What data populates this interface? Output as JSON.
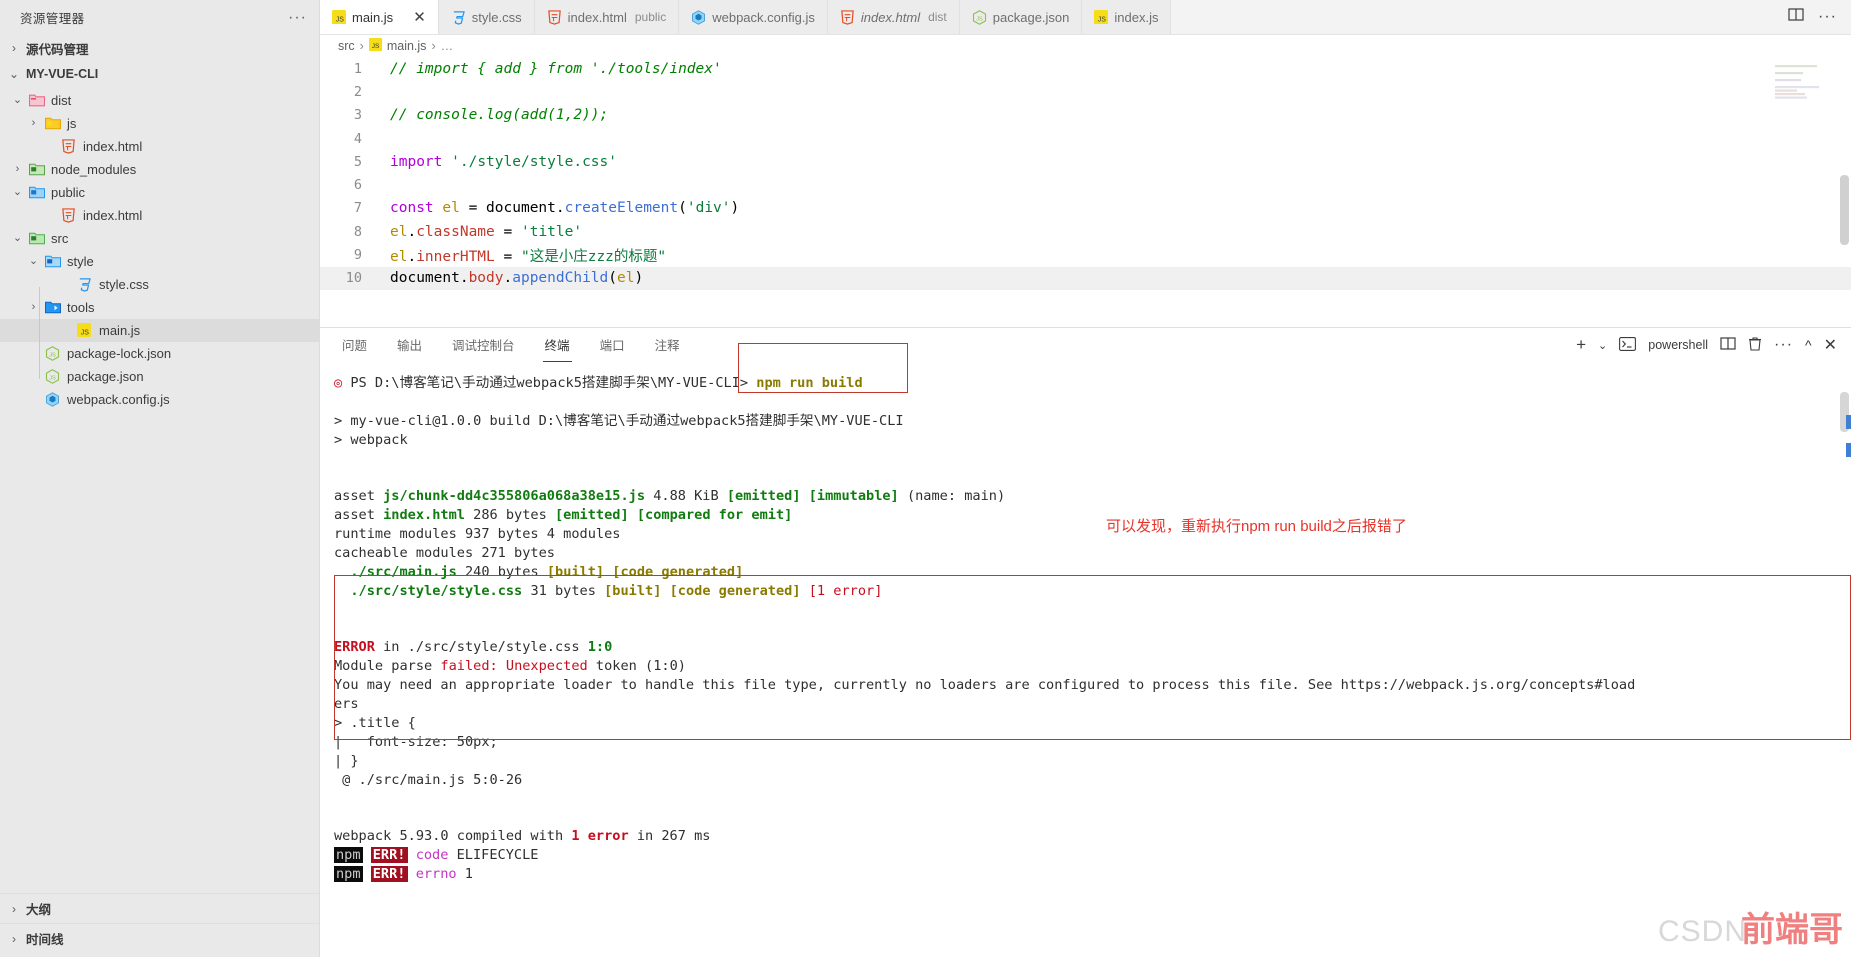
{
  "sidebar": {
    "title": "资源管理器",
    "more_icon": "ellipsis-icon",
    "sections": [
      {
        "label": "源代码管理",
        "expanded": false
      },
      {
        "label": "MY-VUE-CLI",
        "expanded": true
      }
    ],
    "tree": [
      {
        "label": "dist",
        "indent": 1,
        "twisty": "chevron-down",
        "icon": "folder-dist-icon",
        "selected": false
      },
      {
        "label": "js",
        "indent": 2,
        "twisty": "chevron-right",
        "icon": "folder-js-icon",
        "selected": false
      },
      {
        "label": "index.html",
        "indent": 3,
        "twisty": "",
        "icon": "html-file-icon",
        "selected": false
      },
      {
        "label": "node_modules",
        "indent": 1,
        "twisty": "chevron-right",
        "icon": "folder-node-icon",
        "selected": false
      },
      {
        "label": "public",
        "indent": 1,
        "twisty": "chevron-down",
        "icon": "folder-public-icon",
        "selected": false
      },
      {
        "label": "index.html",
        "indent": 3,
        "twisty": "",
        "icon": "html-file-icon",
        "selected": false
      },
      {
        "label": "src",
        "indent": 1,
        "twisty": "chevron-down",
        "icon": "folder-src-icon",
        "selected": false
      },
      {
        "label": "style",
        "indent": 2,
        "twisty": "chevron-down",
        "icon": "folder-style-icon",
        "selected": false
      },
      {
        "label": "style.css",
        "indent": 4,
        "twisty": "",
        "icon": "css-file-icon",
        "selected": false
      },
      {
        "label": "tools",
        "indent": 2,
        "twisty": "chevron-right",
        "icon": "folder-tools-icon",
        "selected": false
      },
      {
        "label": "main.js",
        "indent": 4,
        "twisty": "",
        "icon": "js-file-icon",
        "selected": true
      },
      {
        "label": "package-lock.json",
        "indent": 2,
        "twisty": "",
        "icon": "json-file-icon",
        "selected": false
      },
      {
        "label": "package.json",
        "indent": 2,
        "twisty": "",
        "icon": "json-file-icon",
        "selected": false
      },
      {
        "label": "webpack.config.js",
        "indent": 2,
        "twisty": "",
        "icon": "webpack-file-icon",
        "selected": false
      }
    ],
    "bottom_sections": [
      {
        "label": "大纲",
        "expanded": false
      },
      {
        "label": "时间线",
        "expanded": false
      }
    ]
  },
  "tabs": [
    {
      "label": "main.js",
      "sub": "",
      "icon": "js-file-icon",
      "active": true,
      "preview": false,
      "closable": true
    },
    {
      "label": "style.css",
      "sub": "",
      "icon": "css-file-icon",
      "active": false,
      "preview": false,
      "closable": false
    },
    {
      "label": "index.html",
      "sub": "public",
      "icon": "html-file-icon",
      "active": false,
      "preview": false,
      "closable": false
    },
    {
      "label": "webpack.config.js",
      "sub": "",
      "icon": "webpack-file-icon",
      "active": false,
      "preview": false,
      "closable": false
    },
    {
      "label": "index.html",
      "sub": "dist",
      "icon": "html-file-icon",
      "active": false,
      "preview": true,
      "closable": false
    },
    {
      "label": "package.json",
      "sub": "",
      "icon": "json-file-icon",
      "active": false,
      "preview": false,
      "closable": false
    },
    {
      "label": "index.js",
      "sub": "",
      "icon": "js-file-icon",
      "active": false,
      "preview": false,
      "closable": false
    }
  ],
  "tabbar_actions": [
    {
      "name": "split-editor-icon",
      "glyph": "▯"
    },
    {
      "name": "more-actions-icon",
      "glyph": "···"
    }
  ],
  "breadcrumb": {
    "root": "src",
    "file": "main.js",
    "tail": "…",
    "sep": "›",
    "icon": "js-file-icon"
  },
  "editor": {
    "active_line": 10,
    "lines": [
      {
        "n": 1,
        "text": "// import { add } from './tools/index'"
      },
      {
        "n": 2,
        "text": ""
      },
      {
        "n": 3,
        "text": "// console.log(add(1,2));"
      },
      {
        "n": 4,
        "text": ""
      },
      {
        "n": 5,
        "text": "import './style/style.css'"
      },
      {
        "n": 6,
        "text": ""
      },
      {
        "n": 7,
        "text": "const el = document.createElement('div')"
      },
      {
        "n": 8,
        "text": "el.className = 'title'"
      },
      {
        "n": 9,
        "text": "el.innerHTML = \"这是小庄zzz的标题\""
      },
      {
        "n": 10,
        "text": "document.body.appendChild(el)"
      }
    ]
  },
  "panel": {
    "tabs": [
      {
        "label": "问题",
        "active": false
      },
      {
        "label": "输出",
        "active": false
      },
      {
        "label": "调试控制台",
        "active": false
      },
      {
        "label": "终端",
        "active": true
      },
      {
        "label": "端口",
        "active": false
      },
      {
        "label": "注释",
        "active": false
      }
    ],
    "actions": {
      "new_terminal_icon": "plus-icon",
      "new_terminal_dropdown_icon": "chevron-down-icon",
      "shell_icon": "terminal-icon",
      "shell_name": "powershell",
      "split_icon": "split-panel-icon",
      "kill_icon": "trash-icon",
      "more_icon": "ellipsis-icon",
      "maximize_icon": "chevron-up-icon",
      "close_icon": "close-icon"
    },
    "terminal": {
      "prompt_status_icon": "error-circle-icon",
      "prompt": "PS D:\\博客笔记\\手动通过webpack5搭建脚手架\\MY-VUE-CLI>",
      "command": "npm run build",
      "lines": [
        "> my-vue-cli@1.0.0 build D:\\博客笔记\\手动通过webpack5搭建脚手架\\MY-VUE-CLI",
        "> webpack",
        "",
        "asset js/chunk-dd4c355806a068a38e15.js 4.88 KiB [emitted] [immutable] (name: main)",
        "asset index.html 286 bytes [emitted] [compared for emit]",
        "runtime modules 937 bytes 4 modules",
        "cacheable modules 271 bytes",
        "  ./src/main.js 240 bytes [built] [code generated]",
        "  ./src/style/style.css 31 bytes [built] [code generated] [1 error]"
      ],
      "asset_js_name": "js/chunk-dd4c355806a068a38e15.js",
      "asset_js_size": "4.88 KiB",
      "asset_js_tags": "[emitted] [immutable]",
      "asset_js_suffix": "(name: main)",
      "asset_html_name": "index.html",
      "asset_html_size": "286 bytes",
      "asset_html_tags": "[emitted] [compared for emit]",
      "runtime_modules": "runtime modules 937 bytes 4 modules",
      "cacheable_modules": "cacheable modules 271 bytes",
      "mod1_name": "./src/main.js",
      "mod1_size": "240 bytes",
      "mod1_tags": "[built] [code generated]",
      "mod2_name": "./src/style/style.css",
      "mod2_size": "31 bytes",
      "mod2_tags": "[built] [code generated]",
      "mod2_error": "[1 error]",
      "error_block": {
        "head_label": "ERROR",
        "head_rest": " in ./src/style/style.css ",
        "head_pos": "1:0",
        "line2_a": "Module parse ",
        "line2_b": "failed: Unexpected",
        "line2_c": " token (1:0)",
        "line3": "You may need an appropriate loader to handle this file type, currently no loaders are configured to process this file. See https://webpack.js.org/concepts#load",
        "line4": "ers",
        "line5": "> .title {",
        "line6": "|   font-size: 50px;",
        "line7": "| }",
        "line8": " @ ./src/main.js 5:0-26"
      },
      "summary_pre": "webpack 5.93.0 compiled with ",
      "summary_err": "1 error",
      "summary_post": " in 267 ms",
      "npm_lines": [
        {
          "tag": "npm",
          "err": "ERR!",
          "key": "code",
          "value": "ELIFECYCLE"
        },
        {
          "tag": "npm",
          "err": "ERR!",
          "key": "errno",
          "value": "1"
        }
      ]
    }
  },
  "annotation": "可以发现，重新执行npm run build之后报错了",
  "watermark": {
    "csdn": "CSDN",
    "author": "前端哥"
  },
  "colors": {
    "accent_red": "#c0392b",
    "annotation_red": "#e8332a",
    "terminal_green": "#107c10",
    "terminal_olive": "#8a7a00",
    "terminal_error": "#c50f1f",
    "sidebar_bg": "#e9e9e9",
    "tabbar_bg": "#f3f3f3"
  }
}
